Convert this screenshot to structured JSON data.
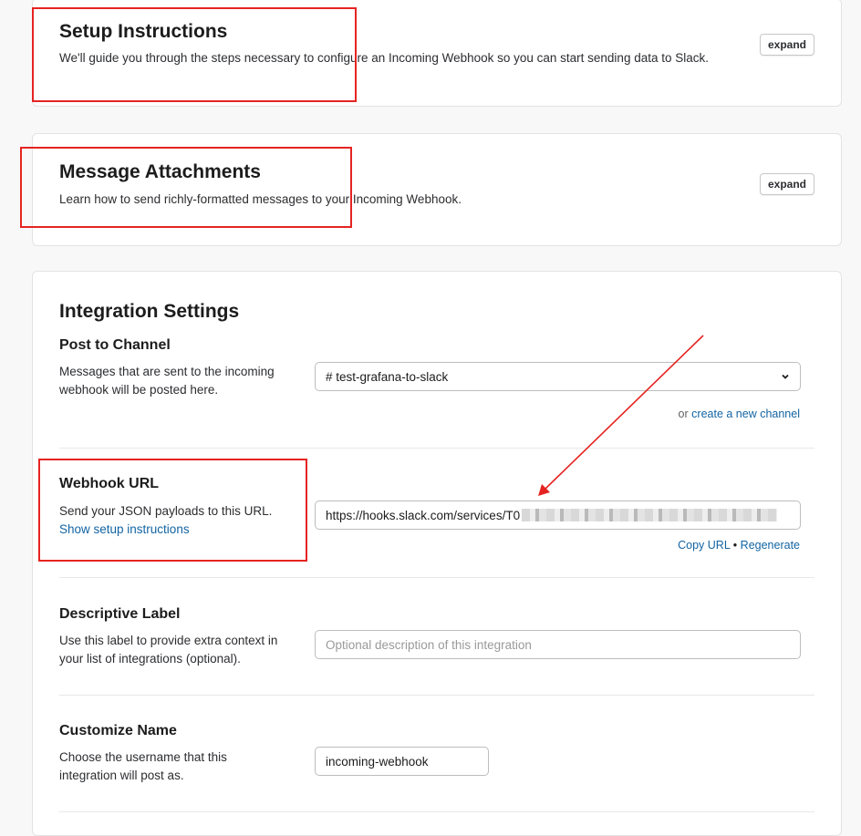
{
  "setup": {
    "title": "Setup Instructions",
    "description": "We'll guide you through the steps necessary to configure an Incoming Webhook so you can start sending data to Slack.",
    "expand_label": "expand"
  },
  "attachments": {
    "title": "Message Attachments",
    "description": "Learn how to send richly-formatted messages to your Incoming Webhook.",
    "expand_label": "expand"
  },
  "settings": {
    "title": "Integration Settings",
    "post_to_channel": {
      "title": "Post to Channel",
      "description": "Messages that are sent to the incoming webhook will be posted here.",
      "selected_channel": "# test-grafana-to-slack",
      "or_text": "or",
      "create_channel_link": "create a new channel"
    },
    "webhook_url": {
      "title": "Webhook URL",
      "description": "Send your JSON payloads to this URL.",
      "setup_link": "Show setup instructions",
      "value": "https://hooks.slack.com/services/T0",
      "copy_link": "Copy URL",
      "separator": "•",
      "regenerate_link": "Regenerate"
    },
    "descriptive_label": {
      "title": "Descriptive Label",
      "description": "Use this label to provide extra context in your list of integrations (optional).",
      "placeholder": "Optional description of this integration"
    },
    "customize_name": {
      "title": "Customize Name",
      "description": "Choose the username that this integration will post as.",
      "value": "incoming-webhook"
    }
  },
  "colors": {
    "annotation_red": "#e52421",
    "link_blue": "#1264a3"
  }
}
